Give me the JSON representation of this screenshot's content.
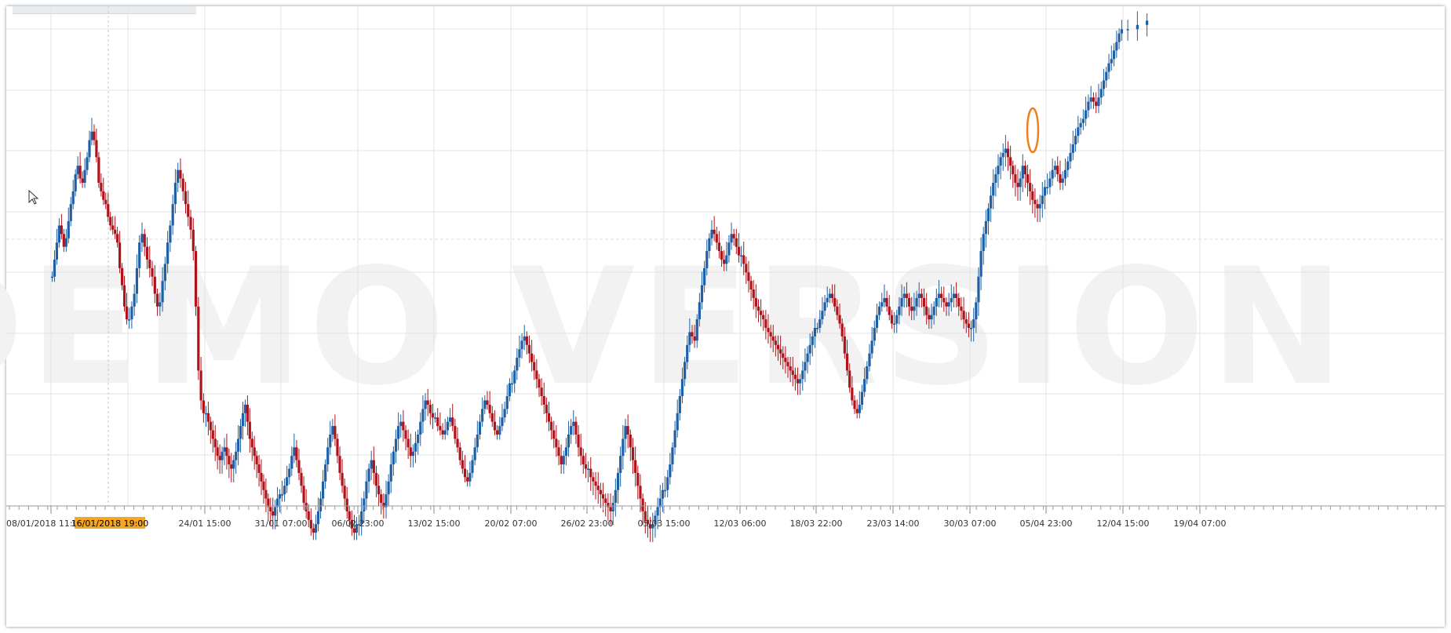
{
  "watermark": "DEMO VERSION",
  "crosshair": {
    "label": "16/01/2018 19:00",
    "color": "#f5a623"
  },
  "colors": {
    "up": "#1f5fa5",
    "down": "#b0121a",
    "grid": "#e3e3e3",
    "highlight": "#f07f1a"
  },
  "chart_data": {
    "type": "candlestick",
    "title": "",
    "xlabel": "",
    "ylabel": "",
    "x_tick_labels": [
      "08/01/2018 11:00",
      "16/01/2018 19:00",
      "24/01 15:00",
      "31/01 07:00",
      "06/02 23:00",
      "13/02 15:00",
      "20/02 07:00",
      "26/02 23:00",
      "05/03 15:00",
      "12/03 06:00",
      "18/03 22:00",
      "23/03 14:00",
      "30/03 07:00",
      "05/04 23:00",
      "12/04 15:00",
      "19/04 07:00"
    ],
    "y_range": [
      0,
      100
    ],
    "grid": true,
    "series": [
      {
        "x": "08/01/2018 11:00",
        "close_path": [
          62,
          66,
          70,
          74,
          72,
          69,
          71,
          75,
          79,
          82,
          86,
          88,
          85,
          84,
          87,
          90,
          94,
          96,
          94,
          90,
          84,
          82,
          80,
          79,
          76,
          74,
          73,
          72,
          70,
          64,
          60,
          55,
          52
        ]
      },
      {
        "x": "16/01/2018 19:00",
        "close_path": [
          52,
          55,
          58,
          64,
          70,
          72,
          69,
          66,
          64,
          62,
          58,
          55,
          56,
          61,
          65,
          70,
          74,
          79,
          84,
          87,
          85,
          82,
          79,
          76,
          73,
          68,
          55,
          40,
          33,
          30
        ]
      },
      {
        "x": "24/01 15:00",
        "close_path": [
          30,
          28,
          26,
          24,
          22,
          20,
          19,
          21,
          22,
          20,
          18,
          17,
          19,
          21,
          24,
          27,
          30,
          32,
          28,
          24,
          22,
          20,
          18,
          16,
          14,
          12,
          10,
          8,
          7,
          6,
          8,
          10,
          11
        ]
      },
      {
        "x": "31/01 07:00",
        "close_path": [
          11,
          13,
          15,
          17,
          20,
          22,
          19,
          16,
          13,
          9,
          7,
          5,
          3,
          2,
          4,
          7,
          10,
          14,
          18,
          22,
          25,
          27,
          24,
          20,
          16,
          13,
          10,
          7,
          5,
          3,
          2,
          4
        ]
      },
      {
        "x": "06/02 23:00",
        "close_path": [
          4,
          7,
          10,
          14,
          17,
          19,
          16,
          13,
          11,
          9,
          8,
          11,
          14,
          18,
          21,
          24,
          27,
          28,
          26,
          24,
          22,
          20,
          21,
          23,
          25,
          28,
          31,
          33,
          32,
          30,
          29
        ]
      },
      {
        "x": "13/02 15:00",
        "close_path": [
          29,
          27,
          26,
          25,
          26,
          28,
          29,
          27,
          24,
          22,
          19,
          17,
          15,
          14,
          16,
          19,
          22,
          25,
          28,
          31,
          33,
          32,
          30,
          28,
          26,
          25,
          27,
          29,
          31,
          34,
          37
        ]
      },
      {
        "x": "20/02 07:00",
        "close_path": [
          37,
          40,
          43,
          45,
          47,
          48,
          46,
          44,
          42,
          40,
          38,
          36,
          34,
          32,
          30,
          28,
          26,
          24,
          22,
          20,
          18,
          20,
          22,
          25,
          27,
          28,
          25,
          22,
          20,
          18,
          17
        ]
      },
      {
        "x": "26/02 23:00",
        "close_path": [
          17,
          15,
          14,
          13,
          12,
          11,
          10,
          9,
          8,
          7,
          9,
          12,
          16,
          20,
          24,
          27,
          25,
          22,
          19,
          16,
          13,
          10,
          7,
          5,
          4,
          3,
          4,
          6,
          8,
          10,
          12
        ]
      },
      {
        "x": "05/03 15:00",
        "close_path": [
          12,
          15,
          18,
          22,
          26,
          30,
          34,
          38,
          42,
          46,
          49,
          48,
          47,
          52,
          56,
          60,
          64,
          68,
          71,
          73,
          72,
          70,
          68,
          66,
          65,
          67,
          70,
          72,
          71,
          69,
          67
        ]
      },
      {
        "x": "12/03 06:00",
        "close_path": [
          67,
          65,
          63,
          61,
          59,
          57,
          55,
          54,
          53,
          52,
          50,
          49,
          48,
          47,
          46,
          45,
          44,
          43,
          42,
          41,
          40,
          39,
          38,
          37,
          38,
          40,
          42,
          44,
          46,
          48,
          50
        ]
      },
      {
        "x": "18/03 22:00",
        "close_path": [
          50,
          52,
          54,
          56,
          57,
          58,
          57,
          55,
          53,
          51,
          48,
          44,
          40,
          36,
          33,
          31,
          30,
          32,
          35,
          38,
          41,
          44,
          47,
          50,
          53,
          55,
          56,
          57,
          55,
          53,
          51
        ]
      },
      {
        "x": "23/03 14:00",
        "close_path": [
          51,
          53,
          55,
          57,
          58,
          57,
          55,
          54,
          55,
          57,
          58,
          57,
          55,
          53,
          52,
          53,
          55,
          57,
          58,
          57,
          56,
          55,
          56,
          57,
          58,
          57,
          55,
          54,
          52,
          51,
          50
        ]
      },
      {
        "x": "30/03 07:00",
        "close_path": [
          50,
          52,
          56,
          62,
          68,
          72,
          75,
          78,
          81,
          84,
          86,
          88,
          90,
          91,
          92,
          90,
          88,
          86,
          84,
          83,
          85,
          88,
          86,
          84,
          82,
          80,
          79,
          78,
          79,
          81,
          83
        ]
      },
      {
        "x": "05/04 23:00",
        "close_path": [
          83,
          85,
          87,
          88,
          86,
          84,
          85,
          87,
          89,
          91,
          93,
          95,
          97,
          98,
          99,
          101,
          103,
          104,
          103,
          102,
          104,
          106,
          108,
          110,
          112,
          113,
          115,
          117,
          119,
          120
        ]
      },
      {
        "x": "12/04 15:00",
        "close_path": [
          120,
          121,
          122,
          121,
          120,
          118,
          116,
          118
        ]
      }
    ],
    "highlight": {
      "x": "05/04 23:00",
      "shape": "ellipse"
    }
  }
}
